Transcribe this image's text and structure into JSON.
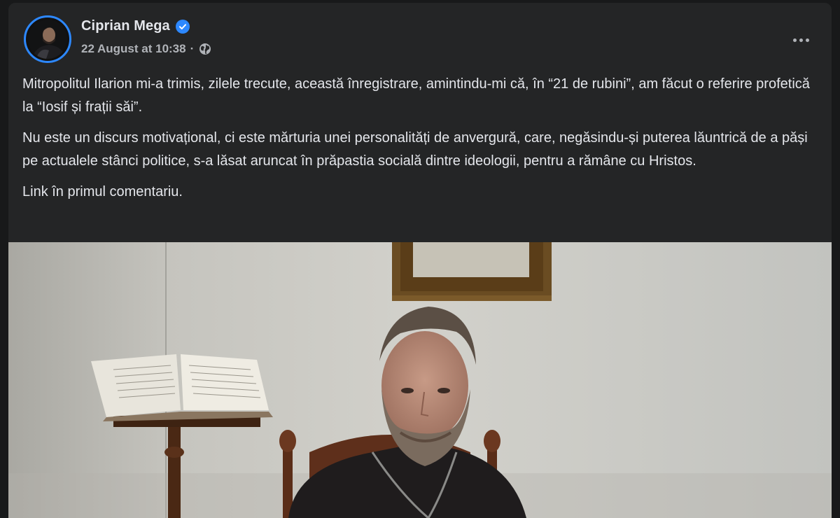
{
  "post": {
    "author": "Ciprian Mega",
    "verified_icon": "verified-badge-icon",
    "timestamp": "22 August at 10:38",
    "separator": "·",
    "audience_icon": "globe-icon",
    "more_icon": "more-options-icon",
    "paragraphs": [
      "Mitropolitul Ilarion mi-a trimis, zilele trecute, această înregistrare, amintindu-mi că, în “21 de rubini”, am făcut o referire profetică la “Iosif și frații săi”.",
      "Nu este un discurs motivațional, ci este mărturia unei personalități de anvergură, care, negăsindu-și puterea lăuntrică de a păși pe actualele stânci politice, s-a lăsat aruncat în prăpastia socială dintre ideologii, pentru a rămâne cu Hristos.",
      "Link în primul comentariu."
    ]
  },
  "colors": {
    "page_bg": "#18191a",
    "card_bg": "#242526",
    "text_primary": "#e4e6eb",
    "text_secondary": "#b0b3b8",
    "accent_blue": "#2d88ff"
  }
}
